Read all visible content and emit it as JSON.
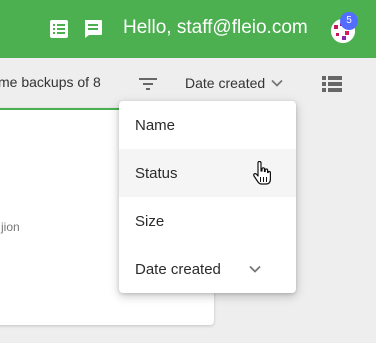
{
  "header": {
    "greeting": "Hello, staff@fleio.com",
    "notification_count": "5",
    "icons": [
      "list-icon",
      "feedback-icon",
      "avatar"
    ],
    "bar_color": "#4caf50",
    "badge_color": "#536dfe"
  },
  "toolbar": {
    "title": "me backups of 8",
    "sort_label": "Date created",
    "icons": [
      "filter-icon",
      "chevron-down-icon",
      "view-list-icon"
    ]
  },
  "card": {
    "text": "jion"
  },
  "sort_menu": {
    "items": [
      {
        "label": "Name"
      },
      {
        "label": "Status",
        "hovered": true
      },
      {
        "label": "Size"
      },
      {
        "label": "Date created",
        "selected": true
      }
    ]
  }
}
